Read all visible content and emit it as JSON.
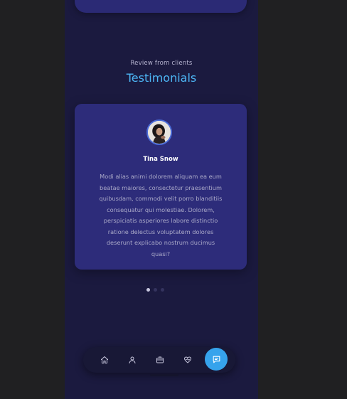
{
  "section": {
    "subtitle": "Review from clients",
    "title": "Testimonials"
  },
  "testimonial": {
    "name": "Tina Snow",
    "quote": "Modi alias animi dolorem aliquam ea eum beatae maiores, consectetur praesentium quibusdam, commodi velit porro blanditiis consequatur qui molestiae. Dolorem, perspiciatis asperiores labore distinctio ratione delectus voluptatem dolores deserunt explicabo nostrum ducimus quasi?",
    "avatar_icon": "user-photo"
  },
  "carousel": {
    "count": 3,
    "active": 0
  },
  "nav": {
    "items": [
      {
        "icon": "home-icon"
      },
      {
        "icon": "user-icon"
      },
      {
        "icon": "briefcase-icon"
      },
      {
        "icon": "heart-pulse-icon"
      },
      {
        "icon": "message-icon",
        "active": true
      }
    ]
  },
  "colors": {
    "background": "#202022",
    "screen": "#1b1a3f",
    "card": "#2d2c7a",
    "accent": "#4db6f5",
    "nav_active": "#36a3ec"
  }
}
